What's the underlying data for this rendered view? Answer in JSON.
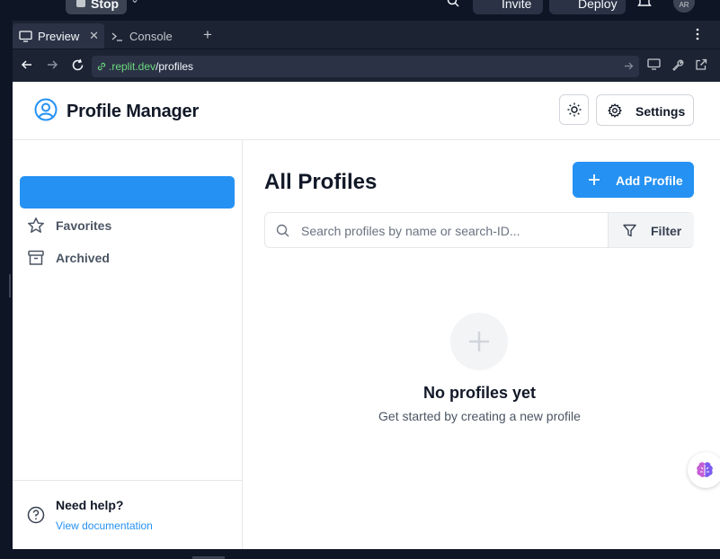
{
  "topbar": {
    "stop_label": "Stop",
    "invite_label": "Invite",
    "deploy_label": "Deploy",
    "avatar_initials": "AR"
  },
  "tabs": [
    {
      "label": "Preview",
      "icon": "monitor-icon",
      "active": true
    },
    {
      "label": "Console",
      "icon": "terminal-icon",
      "active": false
    }
  ],
  "urlbar": {
    "domain": ".replit.dev",
    "path": "/profiles"
  },
  "app": {
    "title": "Profile Manager",
    "settings_label": "Settings",
    "accent": "#2591f3"
  },
  "sidebar": {
    "items": [
      {
        "label": "Favorites",
        "icon": "star-icon"
      },
      {
        "label": "Archived",
        "icon": "archive-icon"
      }
    ],
    "help_title": "Need help?",
    "help_link": "View documentation"
  },
  "main": {
    "title": "All Profiles",
    "add_label": "Add Profile",
    "search_placeholder": "Search profiles by name or search-ID...",
    "filter_label": "Filter",
    "empty_title": "No profiles yet",
    "empty_subtitle": "Get started by creating a new profile"
  }
}
